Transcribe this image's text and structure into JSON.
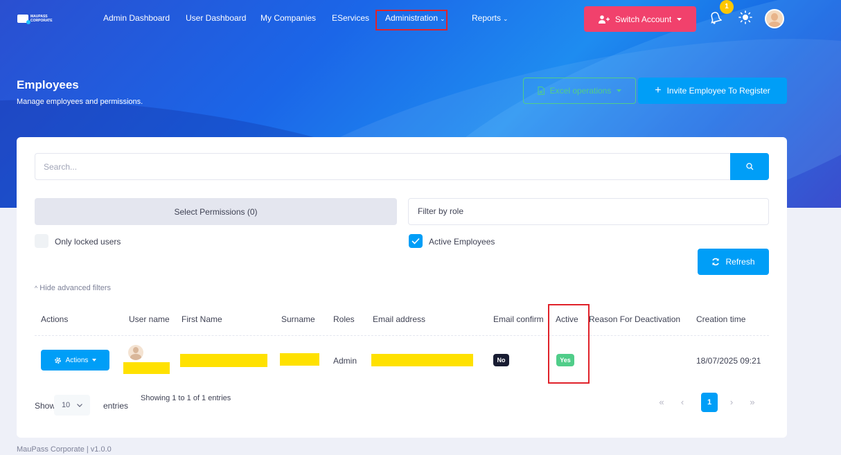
{
  "logo": {
    "line1": "MAUPASS",
    "line2": "CORPORATE"
  },
  "nav": {
    "items": [
      {
        "label": "Admin Dashboard"
      },
      {
        "label": "User Dashboard"
      },
      {
        "label": "My Companies"
      },
      {
        "label": "EServices"
      },
      {
        "label": "Administration",
        "chevron": "⌄"
      },
      {
        "label": "Reports",
        "chevron": "⌄"
      }
    ],
    "switch_account": "Switch Account",
    "notification_count": "1"
  },
  "header": {
    "title": "Employees",
    "subtitle": "Manage employees and permissions.",
    "excel_label": "Excel operations",
    "invite_label": "Invite Employee To Register"
  },
  "filters": {
    "search_placeholder": "Search...",
    "permissions_label": "Select Permissions (0)",
    "role_placeholder": "Filter by role",
    "only_locked_label": "Only locked users",
    "only_locked_checked": false,
    "active_label": "Active Employees",
    "active_checked": true,
    "refresh_label": "Refresh",
    "hide_advanced": "Hide advanced filters"
  },
  "table": {
    "columns": [
      "Actions",
      "User name",
      "First Name",
      "Surname",
      "Roles",
      "Email address",
      "Email confirm",
      "Active",
      "Reason For Deactivation",
      "Creation time"
    ],
    "rows": [
      {
        "actions": "Actions",
        "roles": "Admin",
        "email_confirm": "No",
        "active": "Yes",
        "reason": "",
        "creation_time": "18/07/2025 09:21"
      }
    ]
  },
  "pagination": {
    "show": "Show",
    "page_length": "10",
    "entries": "entries",
    "showing": "Showing 1 to 1 of 1 entries",
    "first": "«",
    "prev": "‹",
    "current": "1",
    "next": "›",
    "last": "»"
  },
  "footer": "MauPass Corporate | v1.0.0",
  "colors": {
    "primary": "#009ef7",
    "danger": "#f1416c",
    "success": "#50cd89",
    "highlight": "#e0222a"
  }
}
